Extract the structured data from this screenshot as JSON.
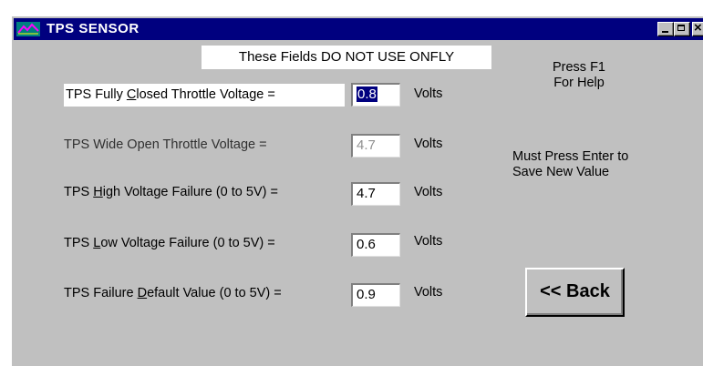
{
  "window": {
    "title": "TPS SENSOR"
  },
  "note": "These Fields DO NOT USE ONFLY",
  "rows": [
    {
      "pre": "TPS Fully ",
      "ul": "C",
      "post": "losed Throttle Voltage =",
      "value": "0.8",
      "unit": "Volts"
    },
    {
      "pre": "TPS Wide Open Throttle Voltage =",
      "ul": "",
      "post": "",
      "value": "4.7",
      "unit": "Volts"
    },
    {
      "pre": "TPS ",
      "ul": "H",
      "post": "igh Voltage Failure (0 to 5V) =",
      "value": "4.7",
      "unit": "Volts"
    },
    {
      "pre": "TPS ",
      "ul": "L",
      "post": "ow Voltage Failure (0 to 5V) =",
      "value": "0.6",
      "unit": "Volts"
    },
    {
      "pre": "TPS Failure ",
      "ul": "D",
      "post": "efault Value (0 to 5V) =",
      "value": "0.9",
      "unit": "Volts"
    }
  ],
  "help": {
    "line1": "Press F1",
    "line2": "For Help"
  },
  "hint": {
    "line1": "Must Press Enter to",
    "line2": "Save New Value"
  },
  "back_label": "<< Back"
}
